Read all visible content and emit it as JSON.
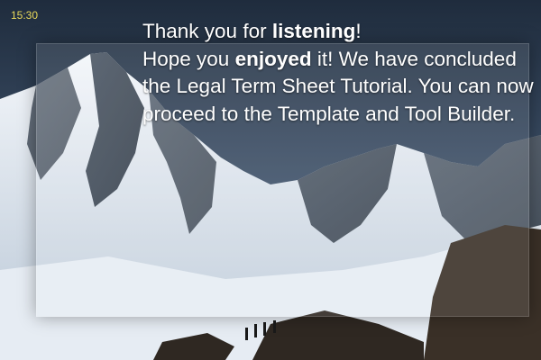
{
  "clock": {
    "time": "15:30"
  },
  "message": {
    "line1_prefix": "Thank you for ",
    "line1_bold": "listening",
    "line1_suffix": "!",
    "line2_prefix": "Hope you ",
    "line2_bold": "enjoyed",
    "line2_suffix": " it! We have concluded the Legal Term Sheet Tutorial. You can now proceed to the Template and Tool Builder."
  },
  "background": {
    "image": "snow-mountain-landscape-photo"
  },
  "colors": {
    "clock": "#e8d85a",
    "text": "#ffffff",
    "sky": "#2a3a4e"
  }
}
